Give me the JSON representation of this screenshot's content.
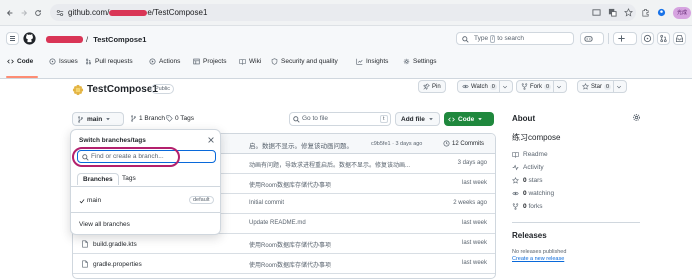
{
  "browser": {
    "url": "github.com/",
    "url_suffix": "e/TestCompose1",
    "profile_label": "光成"
  },
  "header": {
    "repo_sep": "/",
    "repo_name": "TestCompose1",
    "search_prefix": "Type",
    "search_key": "/",
    "search_suffix": "to search"
  },
  "tabs": [
    {
      "label": "Code",
      "icon": "code-icon"
    },
    {
      "label": "Issues",
      "icon": "issue-icon"
    },
    {
      "label": "Pull requests",
      "icon": "pull-request-icon"
    },
    {
      "label": "Actions",
      "icon": "play-icon"
    },
    {
      "label": "Projects",
      "icon": "table-icon"
    },
    {
      "label": "Wiki",
      "icon": "book-icon"
    },
    {
      "label": "Security and quality",
      "icon": "shield-icon"
    },
    {
      "label": "Insights",
      "icon": "graph-icon"
    },
    {
      "label": "Settings",
      "icon": "gear-icon"
    }
  ],
  "repo": {
    "name": "TestCompose1",
    "visibility": "Public",
    "pin": "Pin",
    "watch": "Watch",
    "watch_count": "0",
    "fork": "Fork",
    "fork_count": "0",
    "star": "Star",
    "star_count": "0"
  },
  "toolbar": {
    "branch": "main",
    "branches": "1 Branch",
    "tags": "0 Tags",
    "goto_placeholder": "Go to file",
    "goto_key": "t",
    "add_file": "Add file",
    "code": "Code"
  },
  "commit": {
    "message": "启。数据不显示。修复该动画问题。",
    "hash_time": "c9b5fe1 · 3 days ago",
    "commits": "12 Commits"
  },
  "files": [
    {
      "name": "",
      "message": "动画有问题，导致求进程重启后。数据不显示。修复该动画...",
      "time": "3 days ago"
    },
    {
      "name": "",
      "message": "使用Room数据库存储代办事项",
      "time": "last week"
    },
    {
      "name": "",
      "message": "Initial commit",
      "time": "2 weeks ago"
    },
    {
      "name": "",
      "message": "Update README.md",
      "time": "last week"
    },
    {
      "name": "build.gradle.kts",
      "message": "使用Room数据库存储代办事项",
      "time": "last week"
    },
    {
      "name": "gradle.properties",
      "message": "使用Room数据库存储代办事项",
      "time": "last week"
    }
  ],
  "dropdown": {
    "title": "Switch branches/tags",
    "placeholder": "Find or create a branch...",
    "tab_branches": "Branches",
    "tab_tags": "Tags",
    "branch_item": "main",
    "default_badge": "default",
    "view_all": "View all branches"
  },
  "sidebar": {
    "about": "About",
    "description": "练习compose",
    "items": [
      {
        "icon": "book-icon",
        "label": "Readme",
        "strong": ""
      },
      {
        "icon": "pulse-icon",
        "label": "Activity",
        "strong": ""
      },
      {
        "icon": "star-icon",
        "label": "stars",
        "strong": "0"
      },
      {
        "icon": "eye-icon",
        "label": "watching",
        "strong": "0"
      },
      {
        "icon": "fork-icon",
        "label": "forks",
        "strong": "0"
      }
    ],
    "releases": "Releases",
    "no_releases": "No releases published",
    "create_release": "Create a new release"
  }
}
